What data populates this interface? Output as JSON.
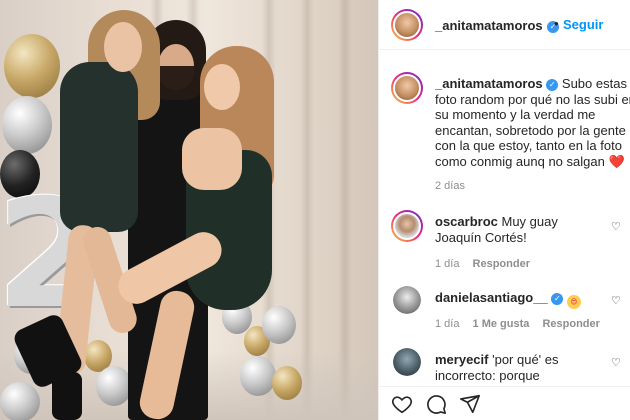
{
  "post": {
    "author": "_anitamatamoros",
    "follow_label": "Seguir",
    "dot": "•",
    "caption": "Subo estas foto random por qué no las subi en su momento y la verdad me encantan, sobretodo por la gente con la que estoy, tanto en la foto como conmig aunq no salgan",
    "caption_emoji": "❤️",
    "time_ago": "2 días"
  },
  "photo": {
    "balloon_number": "2"
  },
  "comments": [
    {
      "username": "oscarbroc",
      "text": "Muy guay Joaquín Cortés!",
      "time": "1 día",
      "likes": "",
      "reply_label": "Responder"
    },
    {
      "username": "danielasantiago__",
      "text": "",
      "emoji": "😍",
      "time": "1 día",
      "likes": "1 Me gusta",
      "reply_label": "Responder"
    },
    {
      "username": "meryecif",
      "text": "'por qué' es incorrecto: porque"
    }
  ],
  "icons": {
    "verified": "verified-badge-icon",
    "heart": "heart-icon",
    "comment": "comment-icon",
    "share": "share-icon"
  },
  "colors": {
    "accent": "#0095f6",
    "verified": "#3897f0",
    "heart_red": "#ed2c3d",
    "muted": "#8e8e8e"
  }
}
